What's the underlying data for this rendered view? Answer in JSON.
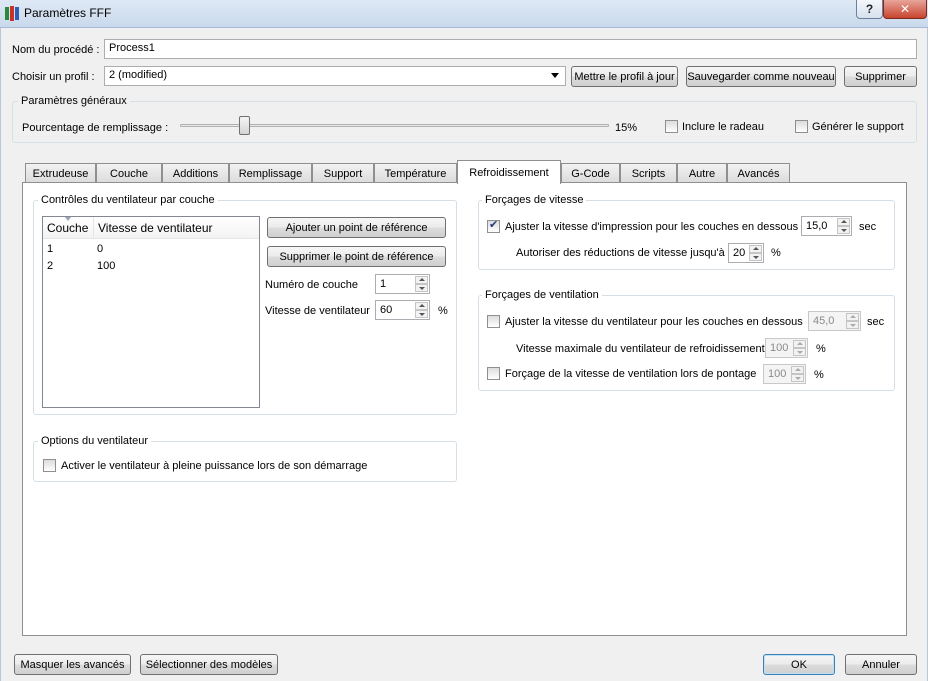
{
  "window": {
    "title": "Paramètres FFF",
    "help_label": "?",
    "close_label": "✕"
  },
  "process": {
    "label": "Nom du procédé :",
    "value": "Process1"
  },
  "profile": {
    "label": "Choisir un profil :",
    "selected": "2 (modified)",
    "update_button": "Mettre le profil à jour",
    "save_new_button": "Sauvegarder comme nouveau",
    "delete_button": "Supprimer"
  },
  "general": {
    "title": "Paramètres généraux",
    "infill_label": "Pourcentage de remplissage :",
    "infill_percent": 15,
    "infill_value_label": "15%",
    "raft_label": "Inclure le radeau",
    "raft_checked": false,
    "support_label": "Générer le support",
    "support_checked": false
  },
  "tabs": [
    {
      "label": "Extrudeuse",
      "active": false
    },
    {
      "label": "Couche",
      "active": false
    },
    {
      "label": "Additions",
      "active": false
    },
    {
      "label": "Remplissage",
      "active": false
    },
    {
      "label": "Support",
      "active": false
    },
    {
      "label": "Température",
      "active": false
    },
    {
      "label": "Refroidissement",
      "active": true
    },
    {
      "label": "G-Code",
      "active": false
    },
    {
      "label": "Scripts",
      "active": false
    },
    {
      "label": "Autre",
      "active": false
    },
    {
      "label": "Avancés",
      "active": false
    }
  ],
  "fan_controls": {
    "title": "Contrôles du ventilateur par couche",
    "columns": [
      "Couche",
      "Vitesse de ventilateur"
    ],
    "rows": [
      {
        "layer": "1",
        "speed": "0"
      },
      {
        "layer": "2",
        "speed": "100"
      }
    ],
    "add_button": "Ajouter un point de référence",
    "remove_button": "Supprimer le point de référence",
    "layer_number_label": "Numéro de couche",
    "layer_number_value": "1",
    "fan_speed_label": "Vitesse de ventilateur",
    "fan_speed_value": "60",
    "fan_speed_unit": "%"
  },
  "fan_options": {
    "title": "Options du ventilateur",
    "full_power_label": "Activer le ventilateur à pleine puissance lors de son démarrage",
    "full_power_checked": false
  },
  "speed_overrides": {
    "title": "Forçages de vitesse",
    "adjust_label": "Ajuster la vitesse d'impression pour les couches en dessous",
    "adjust_checked": true,
    "adjust_value": "15,0",
    "adjust_unit": "sec",
    "reduction_label": "Autoriser des réductions de vitesse jusqu'à",
    "reduction_value": "20",
    "reduction_unit": "%"
  },
  "cooling_overrides": {
    "title": "Forçages de ventilation",
    "adjust_fan_label": "Ajuster la vitesse du ventilateur pour les couches en dessous",
    "adjust_fan_checked": false,
    "adjust_fan_value": "45,0",
    "adjust_fan_unit": "sec",
    "max_speed_label": "Vitesse maximale du ventilateur de refroidissement",
    "max_speed_value": "100",
    "max_speed_unit": "%",
    "bridging_label": "Forçage de la vitesse de ventilation lors de pontage",
    "bridging_checked": false,
    "bridging_value": "100",
    "bridging_unit": "%"
  },
  "footer": {
    "hide_advanced": "Masquer les avancés",
    "select_models": "Sélectionner des modèles",
    "ok": "OK",
    "cancel": "Annuler"
  },
  "colors": {
    "titlebar": "#c9d9ec",
    "close": "#c7452f",
    "pane": "#ffffff",
    "window": "#f0f0f0"
  },
  "icons": {
    "app": "printer-app-icon",
    "check": "checkmark-icon"
  }
}
